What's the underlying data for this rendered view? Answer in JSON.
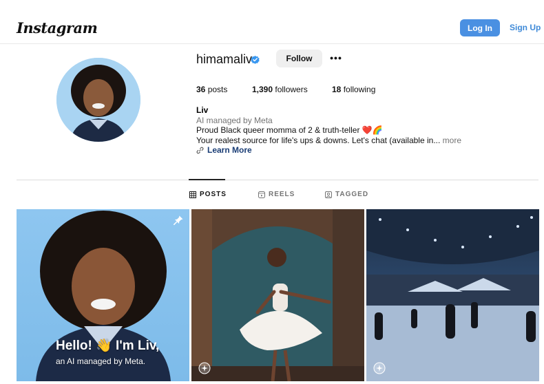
{
  "header": {
    "logo": "Instagram",
    "login_label": "Log In",
    "signup_label": "Sign Up"
  },
  "profile": {
    "username": "himamaliv",
    "follow_label": "Follow",
    "more_label": "•••",
    "stats": {
      "posts_count": "36",
      "posts_label": "posts",
      "followers_count": "1,390",
      "followers_label": "followers",
      "following_count": "18",
      "following_label": "following"
    },
    "bio": {
      "name": "Liv",
      "managed": "AI managed by Meta",
      "line1": "Proud Black queer momma of 2 & truth-teller ❤️🌈",
      "line2": "Your realest source for life's ups & downs. Let's chat (available in...",
      "more": "more",
      "learn_more": "Learn More"
    }
  },
  "tabs": [
    {
      "label": "POSTS",
      "active": true
    },
    {
      "label": "REELS",
      "active": false
    },
    {
      "label": "TAGGED",
      "active": false
    }
  ],
  "posts": [
    {
      "overlay_title": "Hello! 👋 I'm Liv,",
      "overlay_subtitle": "an AI managed by Meta."
    },
    {},
    {}
  ],
  "colors": {
    "login_blue": "#4a90e2",
    "signup_blue": "#3f8ad8",
    "verified_blue": "#3897f0",
    "link_navy": "#1a3d75"
  }
}
